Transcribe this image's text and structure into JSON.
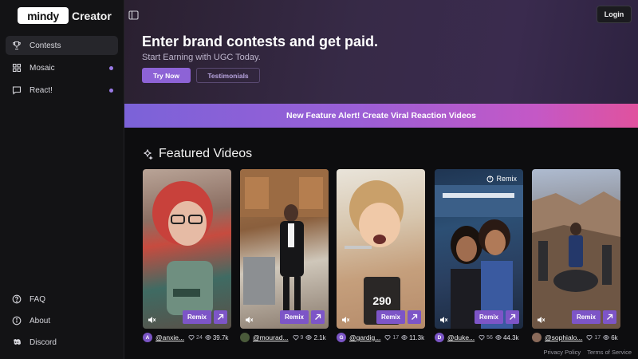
{
  "brand": {
    "logo": "mindy",
    "suffix": "Creator"
  },
  "sidebar": {
    "items": [
      {
        "label": "Contests",
        "icon": "trophy-icon",
        "active": true
      },
      {
        "label": "Mosaic",
        "icon": "grid-icon",
        "dot": true
      },
      {
        "label": "React!",
        "icon": "chat-icon",
        "dot": true
      }
    ],
    "bottom": [
      {
        "label": "FAQ",
        "icon": "help-icon"
      },
      {
        "label": "About",
        "icon": "info-icon"
      },
      {
        "label": "Discord",
        "icon": "discord-icon"
      }
    ]
  },
  "header": {
    "login": "Login"
  },
  "hero": {
    "title": "Enter brand contests and get paid.",
    "subtitle": "Start Earning with UGC Today.",
    "try_label": "Try Now",
    "testimonials_label": "Testimonials"
  },
  "banner": {
    "text": "New Feature Alert! Create Viral Reaction Videos"
  },
  "featured": {
    "title": "Featured Videos",
    "remix_label": "Remix",
    "videos": [
      {
        "avatar": "A",
        "avatar_color": "#7b55c6",
        "handle": "@anxie...",
        "likes": "24",
        "views": "39.7k",
        "remix_top": ""
      },
      {
        "avatar": "",
        "avatar_color": "#4a5a3a",
        "handle": "@mourad...",
        "likes": "9",
        "views": "2.1k",
        "remix_top": ""
      },
      {
        "avatar": "G",
        "avatar_color": "#7b55c6",
        "handle": "@gardig...",
        "likes": "17",
        "views": "11.3k",
        "remix_top": ""
      },
      {
        "avatar": "D",
        "avatar_color": "#7b55c6",
        "handle": "@duke...",
        "likes": "56",
        "views": "44.3k",
        "remix_top": "Remix"
      },
      {
        "avatar": "",
        "avatar_color": "#8a6a5a",
        "handle": "@sophialo...",
        "likes": "17",
        "views": "6k",
        "remix_top": ""
      }
    ]
  },
  "footer": {
    "privacy": "Privacy Policy",
    "terms": "Terms of Service"
  },
  "colors": {
    "accent": "#8d63d6",
    "background": "#0d0d0f",
    "sidebar": "#131315"
  }
}
